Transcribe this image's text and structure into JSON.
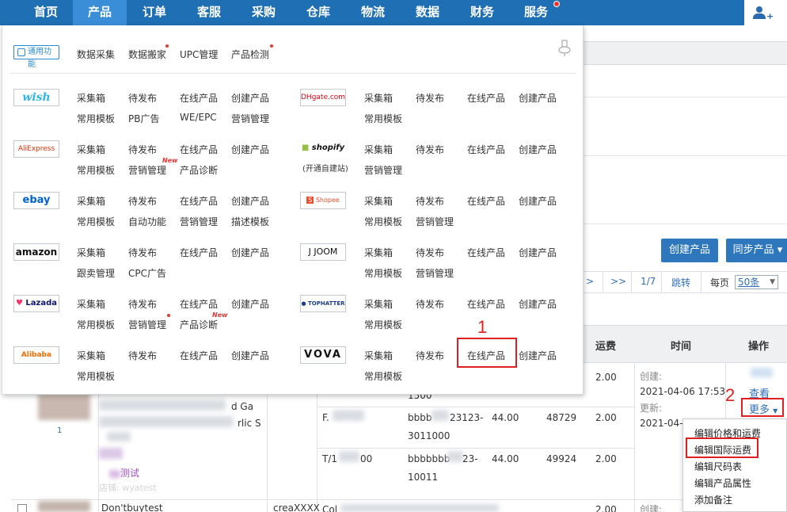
{
  "nav": {
    "items": [
      "首页",
      "产品",
      "订单",
      "客服",
      "采购",
      "仓库",
      "物流",
      "数据",
      "财务",
      "服务"
    ],
    "active_index": 1
  },
  "colors": {
    "nav_bg": "#1f6fb5",
    "nav_active": "#3a8ed8",
    "accent": "#2f77bd",
    "highlight": "#e02020"
  },
  "panel": {
    "tools_badge": "通用功能",
    "tools": [
      "数据采集",
      "数据搬家",
      "UPC管理",
      "产品检测"
    ],
    "new_tag": "New",
    "left_platforms": [
      {
        "logo": "wish",
        "row1": [
          "采集箱",
          "待发布",
          "在线产品",
          "创建产品"
        ],
        "row2": [
          "常用模板",
          "PB广告",
          "WE/EPC",
          "营销管理"
        ]
      },
      {
        "logo": "AliExpress",
        "row1": [
          "采集箱",
          "待发布",
          "在线产品",
          "创建产品"
        ],
        "row2": [
          "常用模板",
          "营销管理",
          "产品诊断"
        ]
      },
      {
        "logo": "ebay",
        "row1": [
          "采集箱",
          "待发布",
          "在线产品",
          "创建产品"
        ],
        "row2": [
          "常用模板",
          "自动功能",
          "营销管理",
          "描述模板"
        ]
      },
      {
        "logo": "amazon",
        "row1": [
          "采集箱",
          "待发布",
          "在线产品",
          "创建产品"
        ],
        "row2": [
          "跟卖管理",
          "CPC广告"
        ]
      },
      {
        "logo": "Lazada",
        "row1": [
          "采集箱",
          "待发布",
          "在线产品",
          "创建产品"
        ],
        "row2": [
          "常用模板",
          "营销管理",
          "产品诊断"
        ]
      },
      {
        "logo": "Alibaba",
        "row1": [
          "采集箱",
          "待发布",
          "在线产品",
          "创建产品"
        ],
        "row2": [
          "常用模板"
        ]
      }
    ],
    "right_platforms": [
      {
        "logo": "DHgate.com",
        "row1": [
          "采集箱",
          "待发布",
          "在线产品",
          "创建产品"
        ],
        "row2": [
          "常用模板"
        ]
      },
      {
        "logo": "shopify",
        "note": "(开通自建站)",
        "row1": [
          "采集箱",
          "待发布",
          "在线产品",
          "创建产品"
        ],
        "row2": [
          "营销管理"
        ]
      },
      {
        "logo": "Shopee",
        "row1": [
          "采集箱",
          "待发布",
          "在线产品",
          "创建产品"
        ],
        "row2": [
          "常用模板",
          "营销管理"
        ]
      },
      {
        "logo": "JOOM",
        "row1": [
          "采集箱",
          "待发布",
          "在线产品",
          "创建产品"
        ],
        "row2": [
          "常用模板",
          "营销管理"
        ]
      },
      {
        "logo": "TOPHATTER",
        "row1": [
          "采集箱",
          "待发布",
          "在线产品",
          "创建产品"
        ],
        "row2": [
          "常用模板"
        ]
      },
      {
        "logo": "VOVA",
        "row1": [
          "采集箱",
          "待发布",
          "在线产品",
          "创建产品"
        ],
        "row2": [
          "常用模板"
        ]
      }
    ]
  },
  "toolbar": {
    "create_label": "创建产品",
    "sync_label": "同步产品 ▾"
  },
  "pager": {
    "next": ">",
    "last": ">>",
    "page": "1/7",
    "jump": "跳转",
    "per_page_label": "每页",
    "per_page_value": "50条"
  },
  "table": {
    "headers": [
      "运费",
      "时间",
      "操作"
    ],
    "rows": [
      {
        "sku_tail": "1500",
        "fee": "2.00"
      },
      {
        "sku_prefix": "F.",
        "sku": "bbbb",
        "sku_mid": "23123-",
        "sku_line2": "3011000",
        "price": "44.00",
        "stock": "48729",
        "fee": "2.00"
      },
      {
        "sku_prefix": "T/1",
        "sku_prefix2": "00",
        "sku": "bbbbbbb",
        "sku_mid": "23-",
        "sku_line2": "10011",
        "price": "44.00",
        "stock": "49924",
        "fee": "2.00"
      },
      {
        "fee": "2.00"
      }
    ],
    "created_label": "创建:",
    "created_time": "2021-04-06 17:53",
    "updated_label": "更新:",
    "updated_time": "2021-04-0",
    "view_link": "查看",
    "more_link": "更多",
    "left_title_frag1": "d Ga",
    "left_title_frag2": "rlic S",
    "left_small": "1",
    "left_test": "测试",
    "left_store": "店铺: wyatest",
    "bottom_title": "Don'tbuytest",
    "bottom_code": "creaXXXX",
    "bottom_col": "Col",
    "bottom_created": "创建:"
  },
  "more_menu": [
    "编辑价格和运费",
    "编辑国际运费",
    "编辑尺码表",
    "编辑产品属性",
    "添加备注"
  ],
  "annotations": [
    "1",
    "2"
  ]
}
